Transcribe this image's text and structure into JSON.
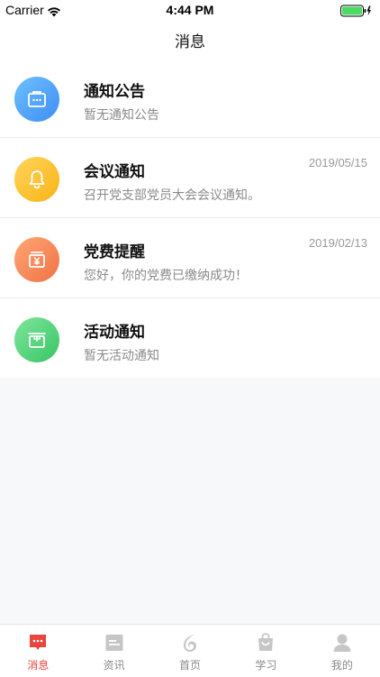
{
  "status_bar": {
    "carrier": "Carrier",
    "time": "4:44 PM"
  },
  "nav": {
    "title": "消息"
  },
  "messages": [
    {
      "title": "通知公告",
      "subtitle": "暂无通知公告",
      "date": "",
      "icon": "briefcase-icon",
      "color": "#4aa3f8"
    },
    {
      "title": "会议通知",
      "subtitle": "召开党支部党员大会会议通知。",
      "date": "2019/05/15",
      "icon": "bell-icon",
      "color": "#fbc02d"
    },
    {
      "title": "党费提醒",
      "subtitle": "您好，你的党费已缴纳成功！",
      "date": "2019/02/13",
      "icon": "yen-box-icon",
      "color": "#f5804f"
    },
    {
      "title": "活动通知",
      "subtitle": "暂无活动通知",
      "date": "",
      "icon": "gift-icon",
      "color": "#4fd47a"
    }
  ],
  "tabs": [
    {
      "label": "消息",
      "icon": "message-icon",
      "active": true
    },
    {
      "label": "资讯",
      "icon": "news-icon",
      "active": false
    },
    {
      "label": "首页",
      "icon": "home-logo-icon",
      "active": false
    },
    {
      "label": "学习",
      "icon": "study-bag-icon",
      "active": false
    },
    {
      "label": "我的",
      "icon": "profile-icon",
      "active": false
    }
  ],
  "colors": {
    "accent": "#e8453c",
    "tab_inactive": "#c6c6c6",
    "battery": "#4cd964"
  }
}
